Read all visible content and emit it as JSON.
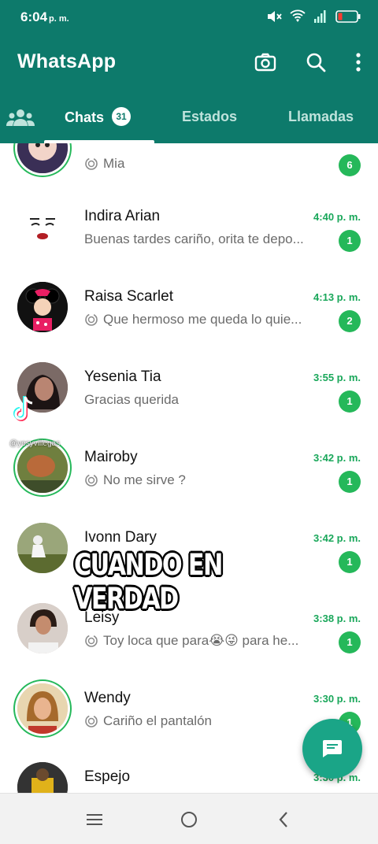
{
  "status_bar": {
    "time": "6:04",
    "time_suffix": "p. m."
  },
  "app_bar": {
    "title": "WhatsApp",
    "icons": [
      "camera-icon",
      "search-icon",
      "more-vert-icon"
    ]
  },
  "tabs": {
    "community_icon": "community-icon",
    "items": [
      {
        "label": "Chats",
        "badge": "31",
        "active": true
      },
      {
        "label": "Estados",
        "active": false
      },
      {
        "label": "Llamadas",
        "active": false
      }
    ]
  },
  "chats": [
    {
      "name": "",
      "preview": "Mia",
      "time": "",
      "unread": "6",
      "status_icon": true
    },
    {
      "name": "Indira Arian",
      "preview": "Buenas tardes cariño, orita te depo...",
      "time": "4:40 p. m.",
      "unread": "1",
      "status_icon": false
    },
    {
      "name": "Raisa Scarlet",
      "preview": "Que hermoso me queda lo quie...",
      "time": "4:13 p. m.",
      "unread": "2",
      "status_icon": true
    },
    {
      "name": "Yesenia Tia",
      "preview": "Gracias querida",
      "time": "3:55 p. m.",
      "unread": "1",
      "status_icon": false
    },
    {
      "name": "Mairoby",
      "preview": "No me sirve ?",
      "time": "3:42 p. m.",
      "unread": "1",
      "status_icon": true
    },
    {
      "name": "Ivonn Dary",
      "preview": "",
      "time": "3:42 p. m.",
      "unread": "1",
      "status_icon": false
    },
    {
      "name": "Leisy",
      "preview": "Toy loca que para😭😜 para he...",
      "time": "3:38 p. m.",
      "unread": "1",
      "status_icon": true
    },
    {
      "name": "Wendy",
      "preview": "Cariño el pantalón",
      "time": "3:30 p. m.",
      "unread": "1",
      "status_icon": true
    },
    {
      "name": "Espejo",
      "preview": "",
      "time": "3:30 p. m.",
      "unread": "",
      "status_icon": false
    }
  ],
  "overlay": {
    "caption": "CUANDO EN VERDAD",
    "watermark_user": "@yesyvillegas"
  },
  "fab": {
    "icon": "new-chat-icon"
  },
  "navbar": {
    "icons": [
      "recent-apps-icon",
      "home-icon",
      "back-icon"
    ]
  },
  "colors": {
    "header": "#0d7a6b",
    "accent_green": "#25b85a",
    "fab": "#1aa587"
  }
}
